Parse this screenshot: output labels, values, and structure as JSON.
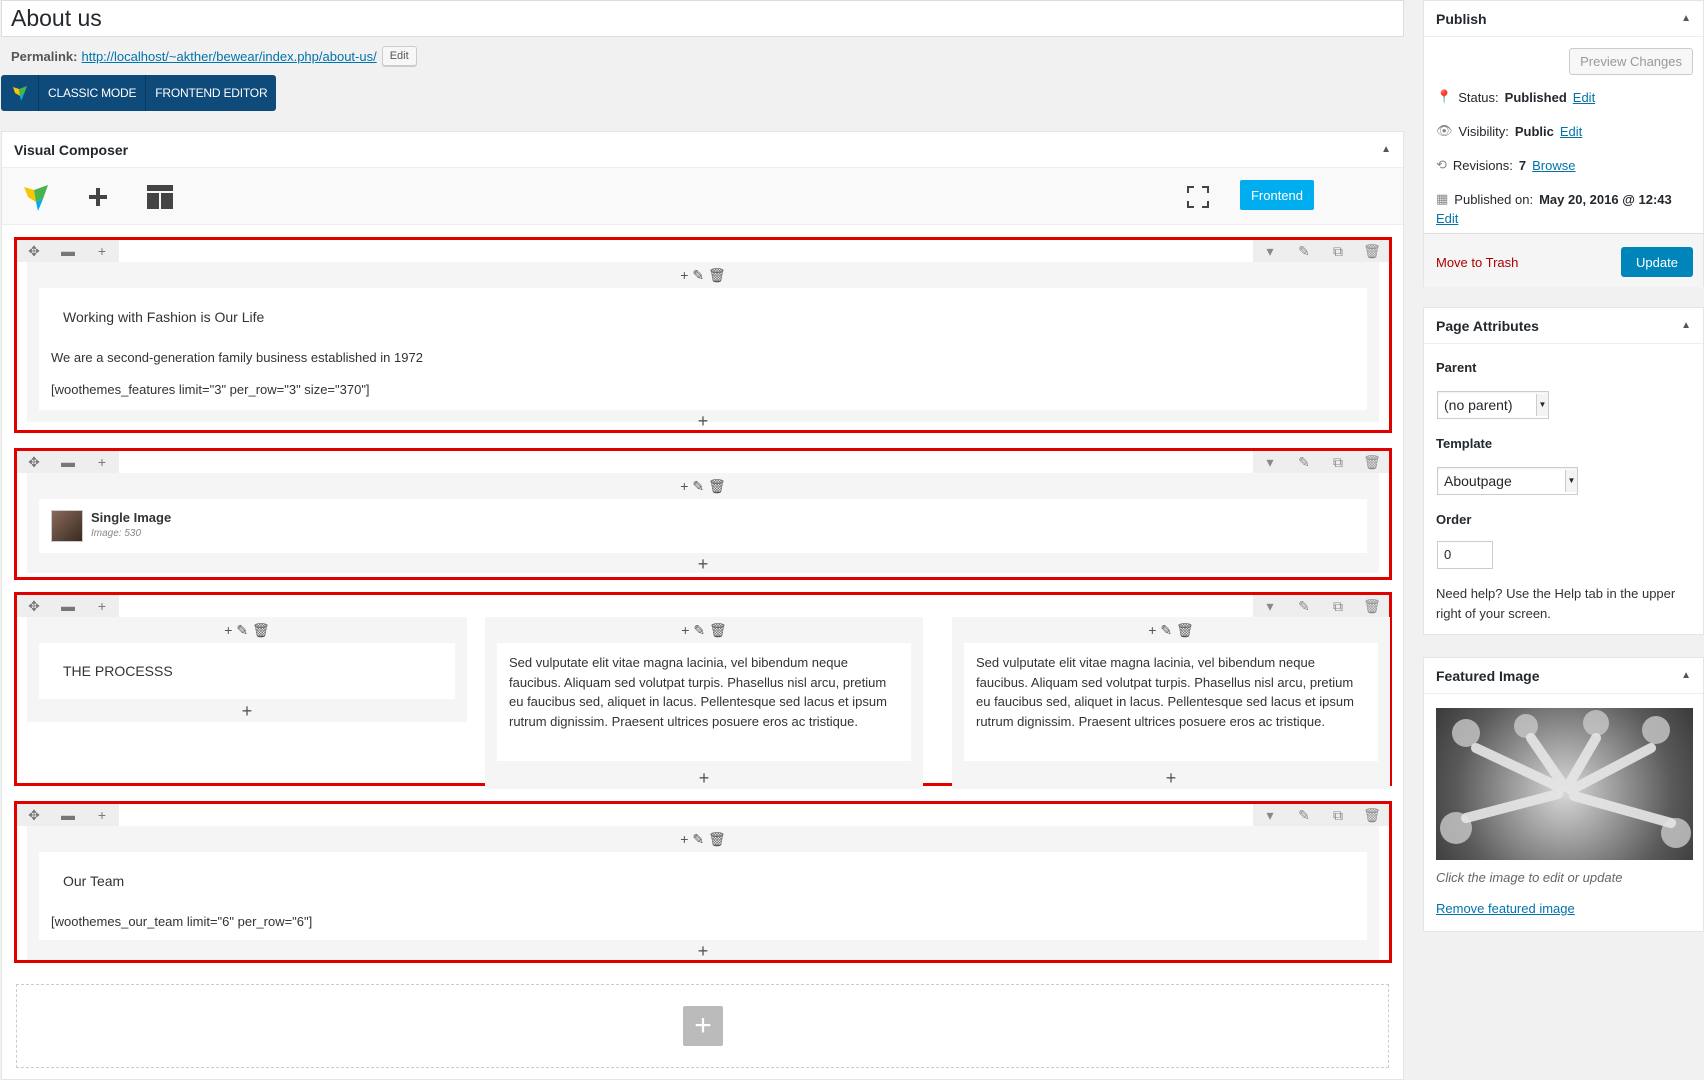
{
  "page": {
    "title": "About us",
    "permalink_label": "Permalink:",
    "permalink_url": "http://localhost/~akther/bewear/index.php/about-us/",
    "permalink_edit": "Edit",
    "mode_classic": "CLASSIC MODE",
    "mode_frontend": "FRONTEND EDITOR"
  },
  "vc": {
    "title": "Visual Composer",
    "frontend_btn": "Frontend",
    "rows": [
      {
        "heading": "Working with Fashion is Our Life",
        "text1": "We are a second-generation family business established in 1972",
        "text2": "[woothemes_features limit=\"3\" per_row=\"3\" size=\"370\"]"
      },
      {
        "image_title": "Single Image",
        "image_sub": "Image: 530"
      },
      {
        "col1": "THE PROCESSS",
        "col2": "Sed vulputate elit vitae magna lacinia, vel bibendum neque faucibus. Aliquam sed volutpat turpis. Phasellus nisl arcu, pretium eu faucibus sed, aliquet in lacus. Pellentesque sed lacus et ipsum rutrum dignissim. Praesent ultrices posuere eros ac tristique.",
        "col3": "Sed vulputate elit vitae magna lacinia, vel bibendum neque faucibus. Aliquam sed volutpat turpis. Phasellus nisl arcu, pretium eu faucibus sed, aliquet in lacus. Pellentesque sed lacus et ipsum rutrum dignissim. Praesent ultrices posuere eros ac tristique."
      },
      {
        "heading": "Our Team",
        "text1": "[woothemes_our_team limit=\"6\" per_row=\"6\"]"
      }
    ]
  },
  "publish": {
    "title": "Publish",
    "preview": "Preview Changes",
    "status_label": "Status:",
    "status_value": "Published",
    "visibility_label": "Visibility:",
    "visibility_value": "Public",
    "revisions_label": "Revisions:",
    "revisions_value": "7",
    "browse": "Browse",
    "published_label": "Published on:",
    "published_value": "May 20, 2016 @ 12:43",
    "edit": "Edit",
    "trash": "Move to Trash",
    "update": "Update"
  },
  "attributes": {
    "title": "Page Attributes",
    "parent_label": "Parent",
    "parent_value": "(no parent)",
    "template_label": "Template",
    "template_value": "Aboutpage",
    "order_label": "Order",
    "order_value": "0",
    "help": "Need help? Use the Help tab in the upper right of your screen."
  },
  "featured": {
    "title": "Featured Image",
    "caption": "Click the image to edit or update",
    "remove": "Remove featured image"
  },
  "colors": {
    "accent": "#0073aa",
    "vc_blue": "#00aef0",
    "highlight": "#e00000"
  }
}
